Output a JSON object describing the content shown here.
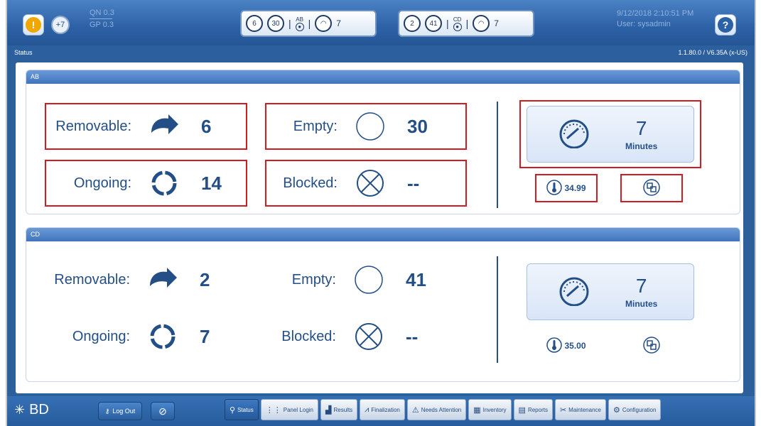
{
  "topbar": {
    "alert_icon": "warning-icon",
    "count_badge": "+7",
    "qn_label": "QN 0.3",
    "gp_label": "GP 0.3",
    "pill_ab": {
      "removable": "6",
      "empty": "30",
      "group": "AB",
      "speed": "7"
    },
    "pill_cd": {
      "removable": "2",
      "empty": "41",
      "group": "CD",
      "speed": "7"
    },
    "datetime": "9/12/2018 2:10:51 PM",
    "user": "User: sysadmin",
    "help_label": "?"
  },
  "status_strip": {
    "title": "Status",
    "version": "1.1.80.0 / V6.35A (x-US)"
  },
  "panels": {
    "ab": {
      "header": "AB",
      "removable_label": "Removable:",
      "removable_value": "6",
      "empty_label": "Empty:",
      "empty_value": "30",
      "ongoing_label": "Ongoing:",
      "ongoing_value": "14",
      "blocked_label": "Blocked:",
      "blocked_value": "--",
      "speed_value": "7",
      "speed_unit": "Minutes",
      "temperature": "34.99"
    },
    "cd": {
      "header": "CD",
      "removable_label": "Removable:",
      "removable_value": "2",
      "empty_label": "Empty:",
      "empty_value": "41",
      "ongoing_label": "Ongoing:",
      "ongoing_value": "7",
      "blocked_label": "Blocked:",
      "blocked_value": "--",
      "speed_value": "7",
      "speed_unit": "Minutes",
      "temperature": "35.00"
    }
  },
  "bottombar": {
    "logo": "BD",
    "logout": "Log Out",
    "tabs": [
      "Status",
      "Panel Login",
      "Results",
      "Finalization",
      "Needs Attention",
      "Inventory",
      "Reports",
      "Maintenance",
      "Configuration"
    ]
  },
  "colors": {
    "highlight": "#d01c23",
    "primary": "#244f86",
    "bar": "#2d5f9b"
  }
}
